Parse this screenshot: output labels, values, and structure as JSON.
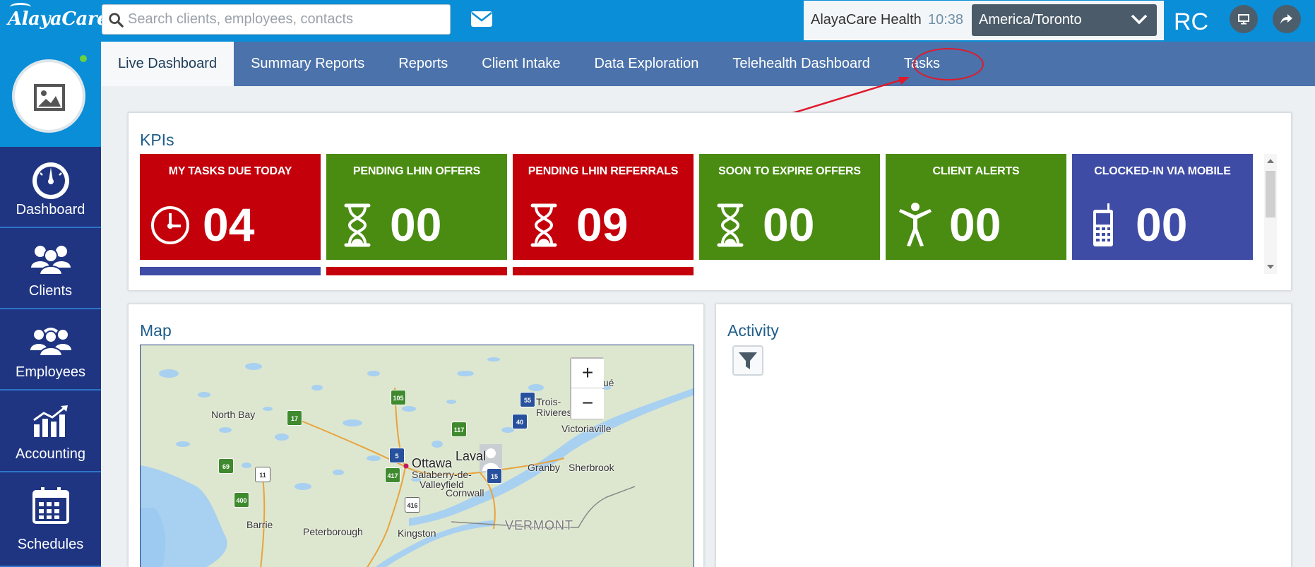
{
  "app": {
    "logo_text": "AlayaCare"
  },
  "header": {
    "search_placeholder": "Search clients, employees, contacts",
    "org_name": "AlayaCare Health",
    "time": "10:38",
    "timezone": "America/Toronto",
    "user_initials": "RC"
  },
  "sidebar": {
    "items": [
      {
        "label": "Dashboard",
        "icon": "gauge-icon"
      },
      {
        "label": "Clients",
        "icon": "users-icon"
      },
      {
        "label": "Employees",
        "icon": "employees-icon"
      },
      {
        "label": "Accounting",
        "icon": "bar-chart-icon"
      },
      {
        "label": "Schedules",
        "icon": "calendar-icon"
      }
    ]
  },
  "tabs": [
    {
      "label": "Live Dashboard",
      "active": true
    },
    {
      "label": "Summary Reports",
      "active": false
    },
    {
      "label": "Reports",
      "active": false
    },
    {
      "label": "Client Intake",
      "active": false
    },
    {
      "label": "Data Exploration",
      "active": false
    },
    {
      "label": "Telehealth Dashboard",
      "active": false
    },
    {
      "label": "Tasks",
      "active": false
    }
  ],
  "kpis": {
    "title": "KPIs",
    "tiles": [
      {
        "title": "MY TASKS DUE TODAY",
        "value": "04",
        "icon": "clock-icon",
        "color": "#c4000b",
        "bar_color": "#3f4ca5"
      },
      {
        "title": "PENDING LHIN OFFERS",
        "value": "00",
        "icon": "hourglass-icon",
        "color": "#4a8c12",
        "bar_color": "#c4000b"
      },
      {
        "title": "PENDING LHIN REFERRALS",
        "value": "09",
        "icon": "hourglass-icon",
        "color": "#c4000b",
        "bar_color": "#c4000b"
      },
      {
        "title": "SOON TO EXPIRE OFFERS",
        "value": "00",
        "icon": "hourglass-icon",
        "color": "#4a8c12"
      },
      {
        "title": "CLIENT ALERTS",
        "value": "00",
        "icon": "person-icon",
        "color": "#4a8c12"
      },
      {
        "title": "CLOCKED-IN VIA MOBILE",
        "value": "00",
        "icon": "mobile-phone-icon",
        "color": "#3f4ca5"
      }
    ]
  },
  "map": {
    "title": "Map",
    "zoom_in": "+",
    "zoom_out": "−",
    "labels": {
      "north_bay": "North Bay",
      "ottawa": "Ottawa",
      "laval": "Laval",
      "trois_rivieres": "Trois-\nRivieres",
      "victoriaville": "Victoriaville",
      "granby": "Granby",
      "sherbrooke": "Sherbrook",
      "salaberry": "Salaberry-de-\nValleyfield",
      "cornwall": "Cornwall",
      "barrie": "Barrie",
      "peterborough": "Peterborough",
      "kingston": "Kingston",
      "vermont": "VERMONT",
      "quebec": "Qué"
    },
    "shields": [
      "105",
      "55",
      "17",
      "40",
      "117",
      "5",
      "69",
      "11",
      "417",
      "15",
      "400",
      "416"
    ]
  },
  "activity": {
    "title": "Activity"
  }
}
